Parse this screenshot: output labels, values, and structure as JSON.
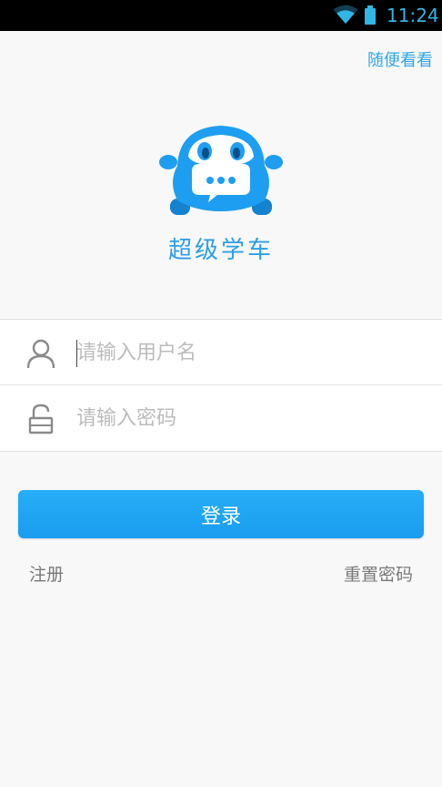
{
  "status_bar": {
    "time": "11:24",
    "icon_color": "#33b5e5"
  },
  "header": {
    "browse_link": "随便看看"
  },
  "brand": {
    "app_name": "超级学车",
    "brand_color": "#1e9ef0"
  },
  "login_form": {
    "username_placeholder": "请输入用户名",
    "password_placeholder": "请输入密码",
    "username_value": "",
    "password_value": ""
  },
  "actions": {
    "login_label": "登录",
    "register_label": "注册",
    "reset_password_label": "重置密码"
  }
}
